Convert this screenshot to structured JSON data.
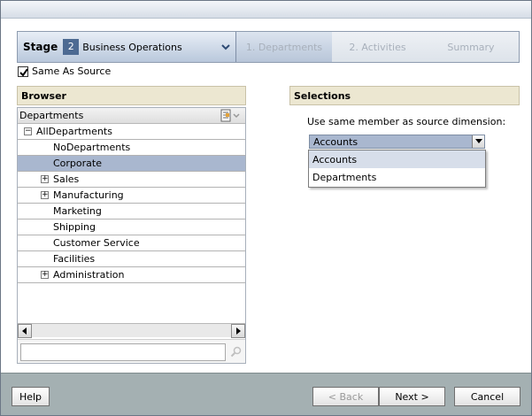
{
  "stage": {
    "label": "Stage",
    "number": "2",
    "name": "Business Operations",
    "steps": [
      "1. Departments",
      "2. Activities",
      "Summary"
    ]
  },
  "same_as_source": {
    "label": "Same As Source",
    "checked": true
  },
  "browser": {
    "title": "Browser",
    "dimension": "Departments",
    "tree": [
      {
        "label": "AllDepartments",
        "level": 0,
        "expander": "−"
      },
      {
        "label": "NoDepartments",
        "level": 1,
        "expander": ""
      },
      {
        "label": "Corporate",
        "level": 1,
        "expander": "",
        "selected": true
      },
      {
        "label": "Sales",
        "level": 1,
        "expander": "+"
      },
      {
        "label": "Manufacturing",
        "level": 1,
        "expander": "+"
      },
      {
        "label": "Marketing",
        "level": 1,
        "expander": ""
      },
      {
        "label": "Shipping",
        "level": 1,
        "expander": ""
      },
      {
        "label": "Customer Service",
        "level": 1,
        "expander": ""
      },
      {
        "label": "Facilities",
        "level": 1,
        "expander": ""
      },
      {
        "label": "Administration",
        "level": 1,
        "expander": "+"
      }
    ],
    "search_value": ""
  },
  "selections": {
    "title": "Selections",
    "prompt": "Use same member as source dimension:",
    "selected": "Accounts",
    "options": [
      "Accounts",
      "Departments"
    ]
  },
  "footer": {
    "help": "Help",
    "back": "< Back",
    "next": "Next >",
    "cancel": "Cancel"
  },
  "colors": {
    "selected_row": "#a9b7cf",
    "footer_bg": "#a4b0b2",
    "panel_header_bg": "#ece7d1"
  }
}
